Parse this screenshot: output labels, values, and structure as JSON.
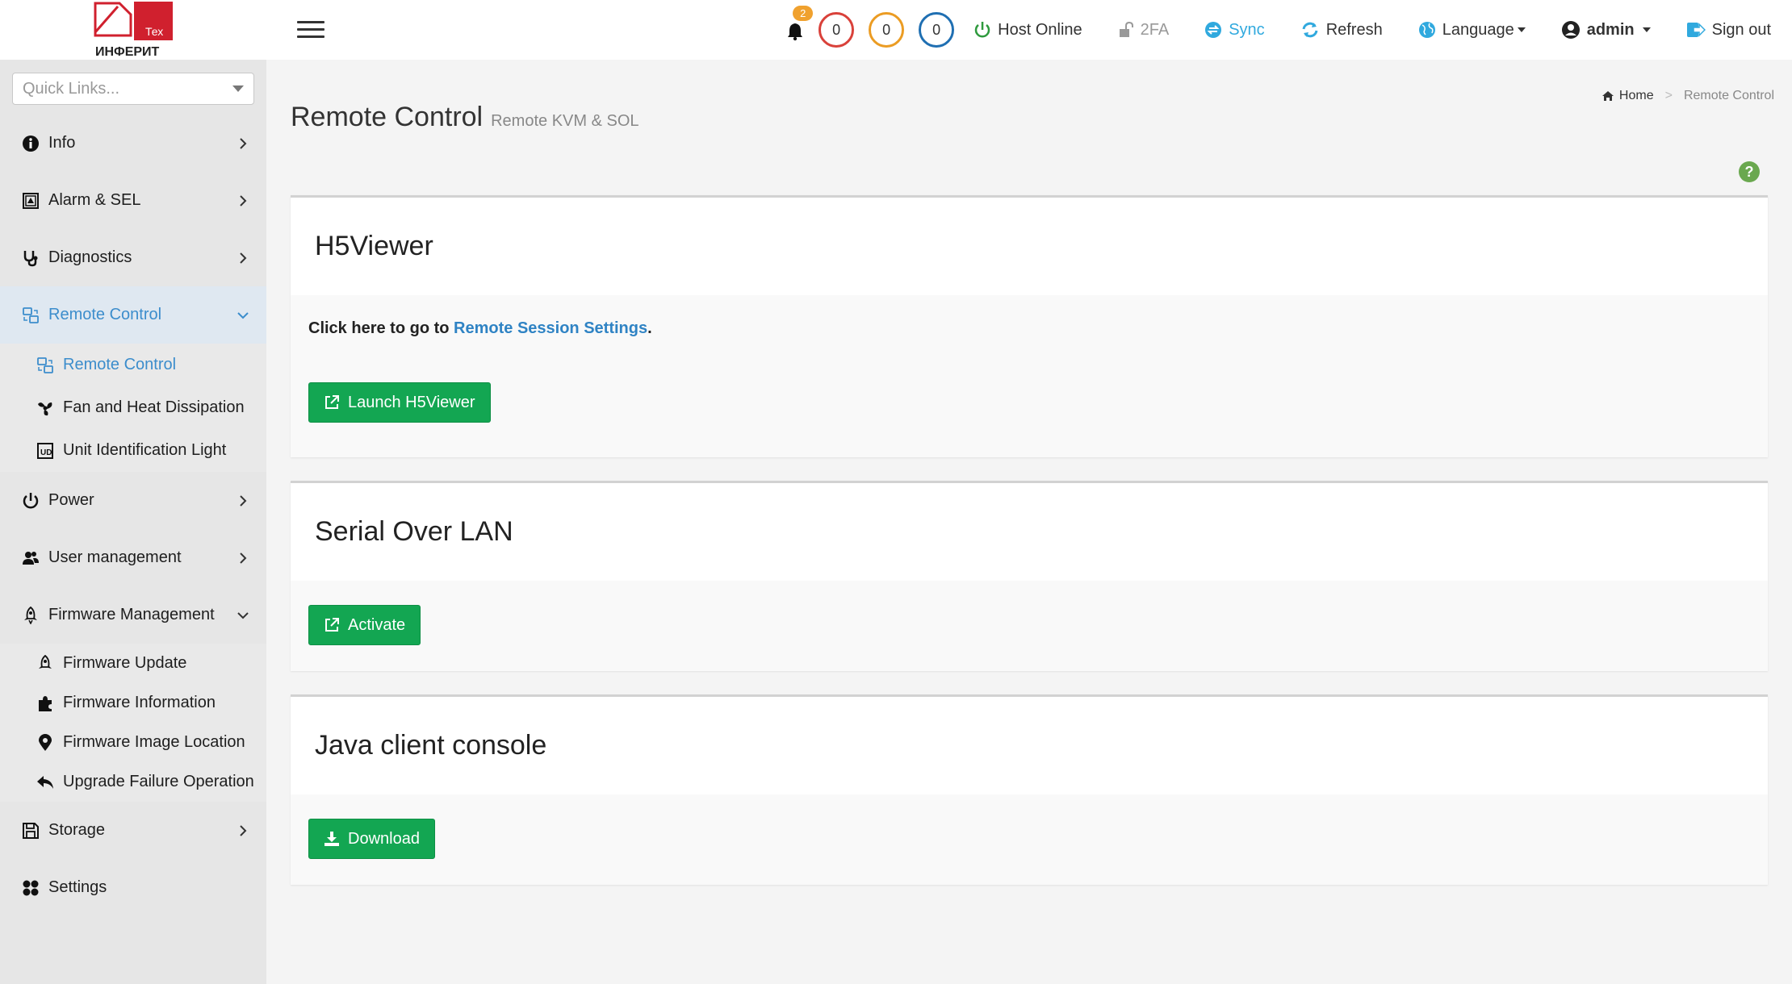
{
  "brand": {
    "logo_word": "ИНФЕРИТ",
    "logo_tag": "Тех",
    "logo_color": "#d0202e"
  },
  "quick_links": {
    "placeholder": "Quick Links..."
  },
  "sidebar": {
    "items": [
      {
        "label": "Info",
        "icon": "info-icon"
      },
      {
        "label": "Alarm & SEL",
        "icon": "alarm-icon"
      },
      {
        "label": "Diagnostics",
        "icon": "stethoscope-icon"
      },
      {
        "label": "Remote Control",
        "icon": "remote-control-icon",
        "active": true,
        "expanded": true
      },
      {
        "label": "Power",
        "icon": "power-icon"
      },
      {
        "label": "User management",
        "icon": "users-icon"
      },
      {
        "label": "Firmware Management",
        "icon": "rocket-icon",
        "expanded": true
      },
      {
        "label": "Storage",
        "icon": "floppy-icon"
      },
      {
        "label": "Settings",
        "icon": "settings-grid-icon"
      }
    ],
    "remote_sub": [
      {
        "label": "Remote Control",
        "icon": "remote-control-icon",
        "active": true
      },
      {
        "label": "Fan and Heat Dissipation",
        "icon": "fan-icon"
      },
      {
        "label": "Unit Identification Light",
        "icon": "uid-light-icon"
      }
    ],
    "firmware_sub": [
      {
        "label": "Firmware Update",
        "icon": "rocket-icon"
      },
      {
        "label": "Firmware Information",
        "icon": "puzzle-icon"
      },
      {
        "label": "Firmware Image Location",
        "icon": "location-pin-icon"
      },
      {
        "label": "Upgrade Failure Operation",
        "icon": "reply-icon"
      }
    ]
  },
  "topbar": {
    "bell_count": "2",
    "circle_red": "0",
    "circle_orange": "0",
    "circle_blue": "0",
    "host_status": "Host Online",
    "twofa": "2FA",
    "sync": "Sync",
    "refresh": "Refresh",
    "language": "Language",
    "user": "admin",
    "signout": "Sign out"
  },
  "page": {
    "title": "Remote Control",
    "subtitle": "Remote KVM & SOL",
    "breadcrumb_home": "Home",
    "breadcrumb_current": "Remote Control",
    "help": "?"
  },
  "panels": {
    "h5": {
      "title": "H5Viewer",
      "text_prefix": "Click here to go to ",
      "link": "Remote Session Settings",
      "text_suffix": ".",
      "button": "Launch H5Viewer"
    },
    "sol": {
      "title": "Serial Over LAN",
      "button": "Activate"
    },
    "java": {
      "title": "Java client console",
      "button": "Download"
    }
  },
  "colors": {
    "accent": "#3c8dcc",
    "button_green": "#13a652",
    "host_online_green": "#2e9a3d",
    "sync_blue": "#30a9de"
  }
}
